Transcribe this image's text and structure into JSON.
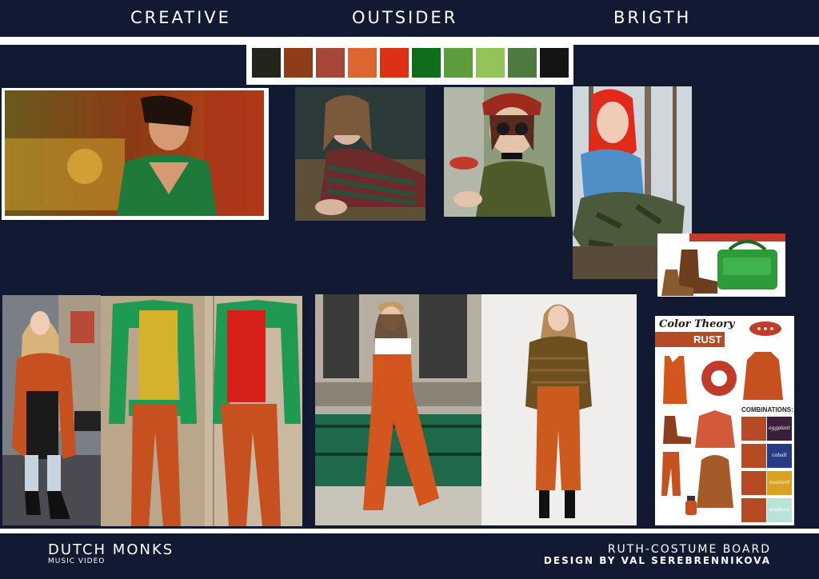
{
  "header": {
    "words": [
      "CREATIVE",
      "OUTSIDER",
      "BRIGTH"
    ]
  },
  "palette": {
    "colors": [
      "#23241a",
      "#8f3c19",
      "#a84637",
      "#dd6530",
      "#dc3114",
      "#0f6e1a",
      "#5d9d3b",
      "#93c45a",
      "#4e7a3f",
      "#141414"
    ]
  },
  "color_theory": {
    "title": "Color Theory",
    "color_name": "RUST",
    "combinations_label": "COMBINATIONS:",
    "combinations": [
      {
        "name": "eggplant",
        "color": "#3b1e3b"
      },
      {
        "name": "cobalt",
        "color": "#263a85"
      },
      {
        "name": "mustard",
        "color": "#d8a21f"
      },
      {
        "name": "seafoam",
        "color": "#b9e3d8"
      }
    ]
  },
  "footer": {
    "project_title": "DUTCH MONKS",
    "project_subtitle": "MUSIC VIDEO",
    "board_title": "RUTH-COSTUME BOARD",
    "designer": "DESIGN BY VAL SEREBRENNIKOVA"
  }
}
